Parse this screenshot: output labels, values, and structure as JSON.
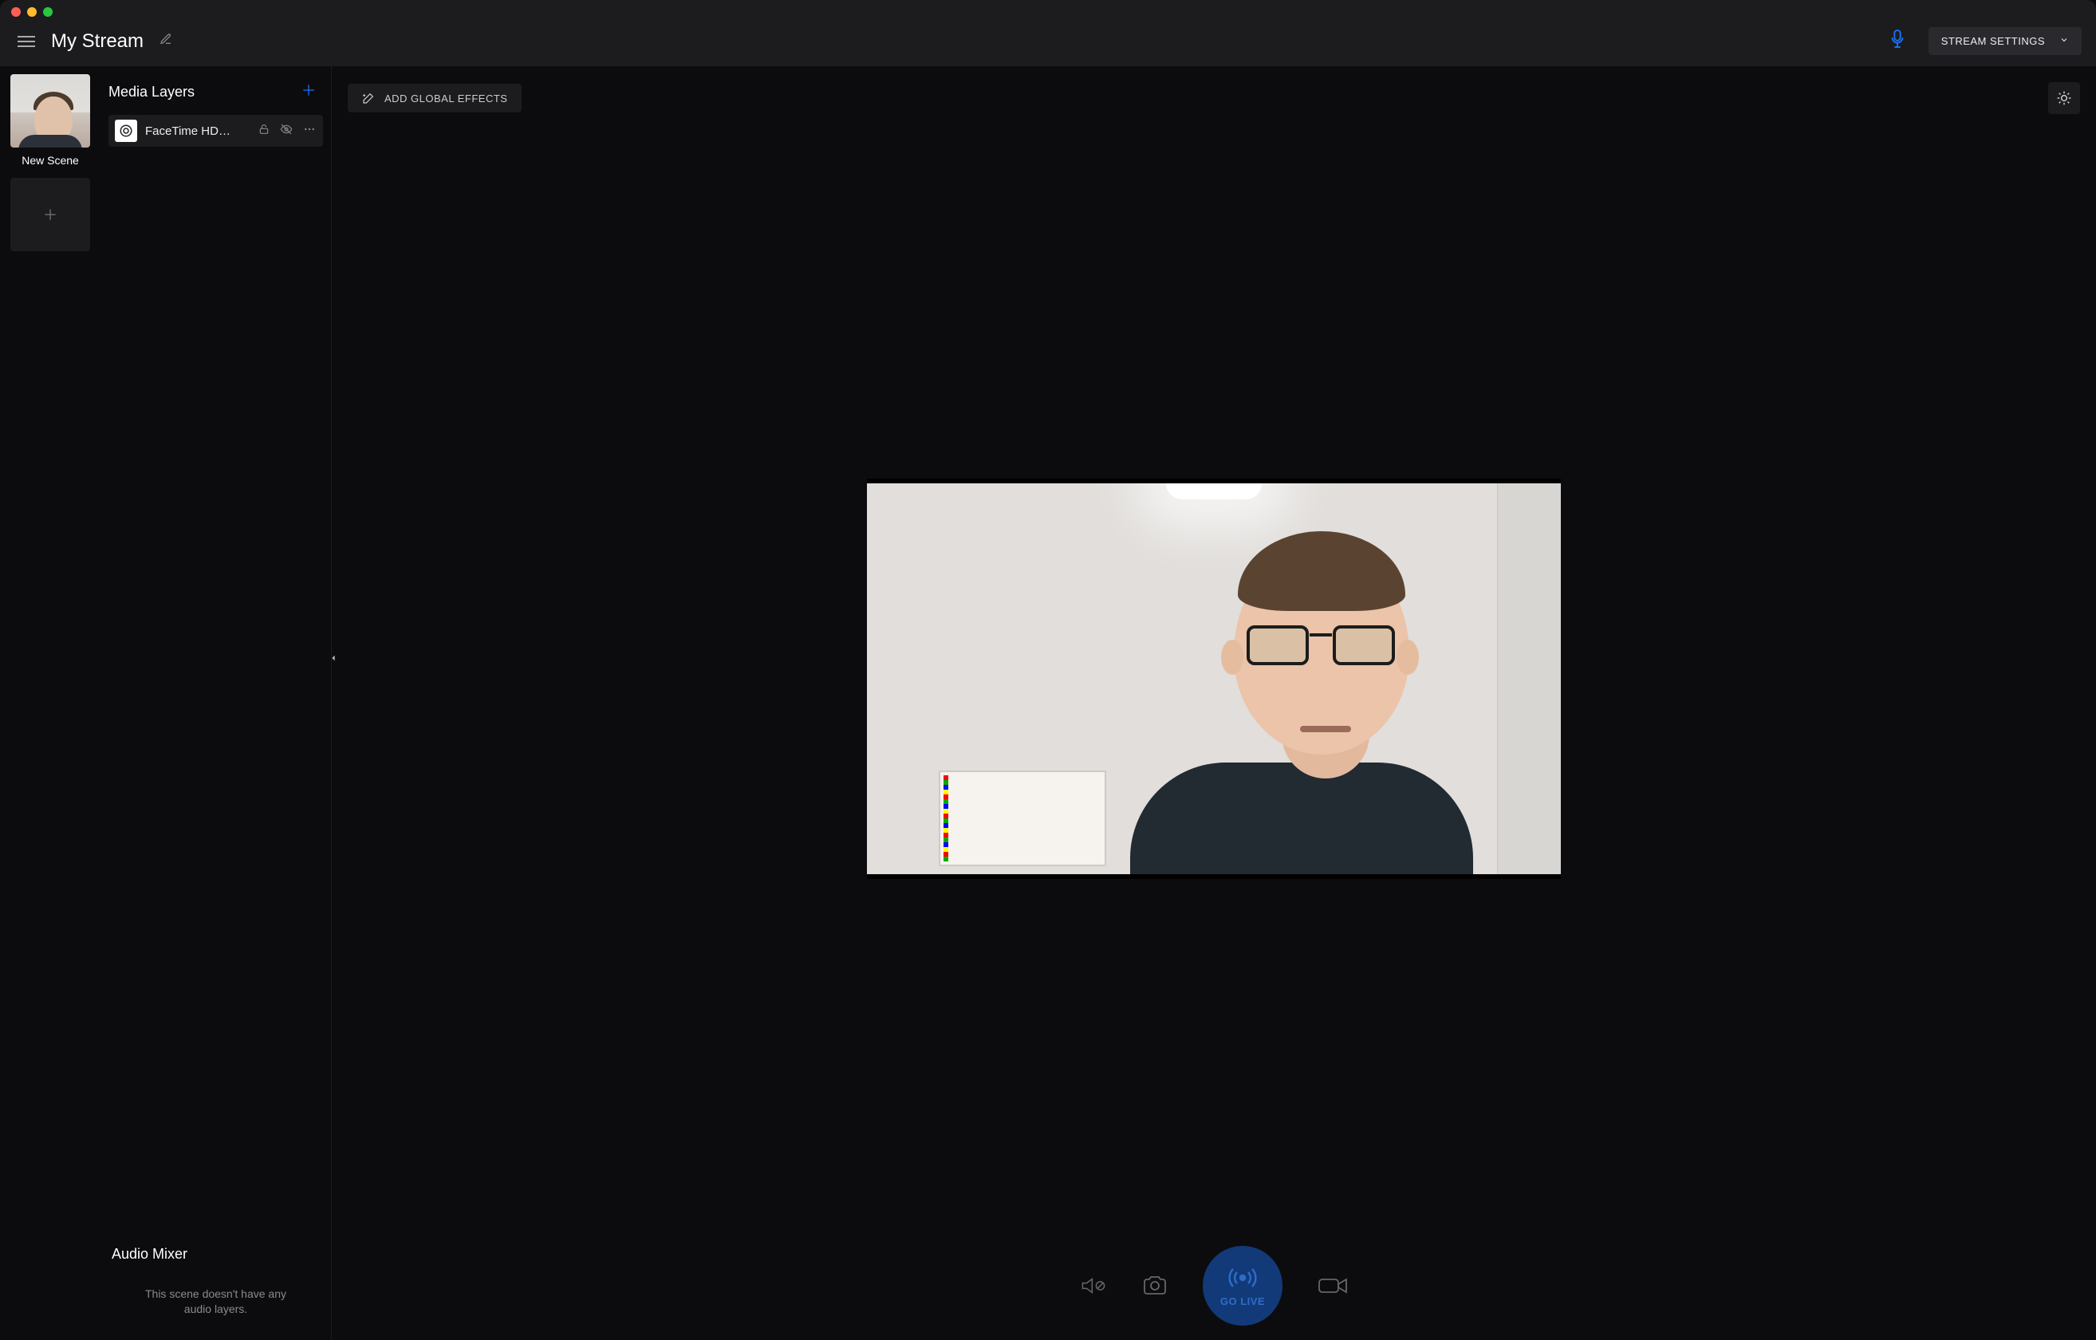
{
  "header": {
    "title": "My Stream",
    "settings_label": "STREAM SETTINGS"
  },
  "scenes": {
    "items": [
      {
        "label": "New Scene"
      }
    ]
  },
  "layers": {
    "title": "Media Layers",
    "items": [
      {
        "name": "FaceTime HD…"
      }
    ]
  },
  "mixer": {
    "title": "Audio Mixer",
    "empty_line1": "This scene doesn't have any",
    "empty_line2": "audio layers."
  },
  "preview": {
    "effects_label": "ADD GLOBAL EFFECTS"
  },
  "bottombar": {
    "go_live_label": "GO LIVE"
  },
  "icons": {
    "mic_top": "microphone-icon",
    "add": "plus-icon",
    "lock": "lock-icon",
    "eye_off": "eye-off-icon",
    "more": "ellipsis-icon",
    "wand": "wand-icon",
    "brightness": "brightness-icon",
    "audio_muted": "audio-muted-icon",
    "camera": "camera-icon",
    "broadcast": "broadcast-icon",
    "video_camera": "video-camera-icon",
    "pencil": "pencil-icon",
    "chevron_left": "chevron-left-icon",
    "chevron_down": "chevron-down-icon",
    "camera_concentric": "camera-source-icon"
  },
  "colors": {
    "accent_blue": "#1a73ff",
    "go_live_bg": "#123a78",
    "go_live_fg": "#2e6cc9",
    "panel_bg": "#1c1c1f",
    "canvas_bg": "#0c0c0f"
  }
}
